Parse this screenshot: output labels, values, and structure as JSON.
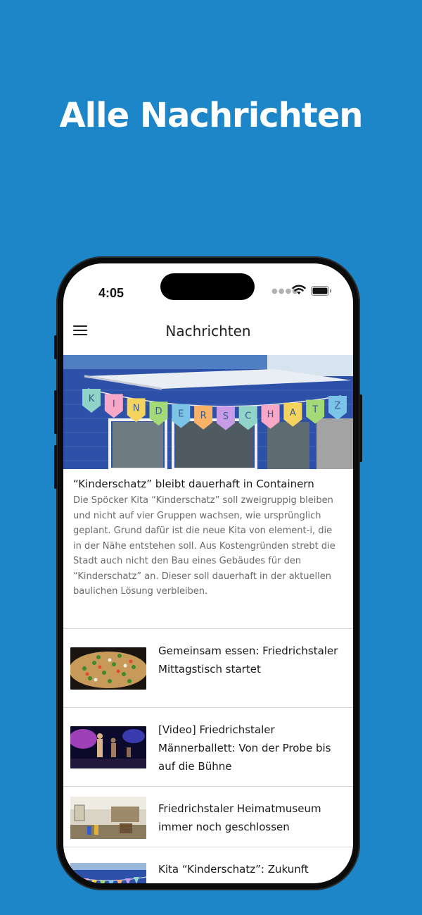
{
  "headline": "Alle Nachrichten",
  "status": {
    "time": "4:05",
    "signal_icon": "signal-dots-icon",
    "wifi_icon": "wifi-icon",
    "battery_icon": "battery-icon"
  },
  "topbar": {
    "title": "Nachrichten",
    "menu_icon": "hamburger-menu-icon"
  },
  "hero": {
    "banner_letters": [
      "K",
      "I",
      "N",
      "D",
      "E",
      "R",
      "S",
      "C",
      "H",
      "A",
      "T",
      "Z"
    ],
    "flag_colors": [
      "#8fd3c9",
      "#f6a8c6",
      "#f4d35e",
      "#a3d977",
      "#7cc3e8",
      "#f7b267",
      "#c79be6",
      "#8fd3c9",
      "#f6a8c6",
      "#f4d35e",
      "#a3d977",
      "#7cc3e8"
    ]
  },
  "featured": {
    "title": "“Kinderschatz” bleibt dauerhaft in Containern",
    "text": "Die Spöcker Kita “Kinderschatz” soll zweigruppig bleiben und nicht auf vier Gruppen wachsen, wie ursprünglich geplant. Grund dafür ist die neue Kita von element-i, die in der Nähe entstehen soll. Aus Kostengründen strebt die Stadt auch nicht den Bau eines Gebäudes für den “Kinderschatz” an. Dieser soll dauerhaft in der aktuellen baulichen Lösung verbleiben."
  },
  "news": [
    {
      "title": "Gemeinsam essen: Friedrichstaler Mittagstisch startet"
    },
    {
      "title": "[Video] Friedrichstaler Männerballett: Von der Probe bis auf die Bühne"
    },
    {
      "title": "Friedrichstaler Heimatmuseum immer noch geschlossen"
    },
    {
      "title": "Kita “Kinderschatz”: Zukunft"
    }
  ],
  "colors": {
    "background": "#1c86c8",
    "phone_frame": "#0b0b0b",
    "text_primary": "#1a1a1a",
    "text_secondary": "#6a6a6a",
    "divider": "#d7d7d7"
  }
}
